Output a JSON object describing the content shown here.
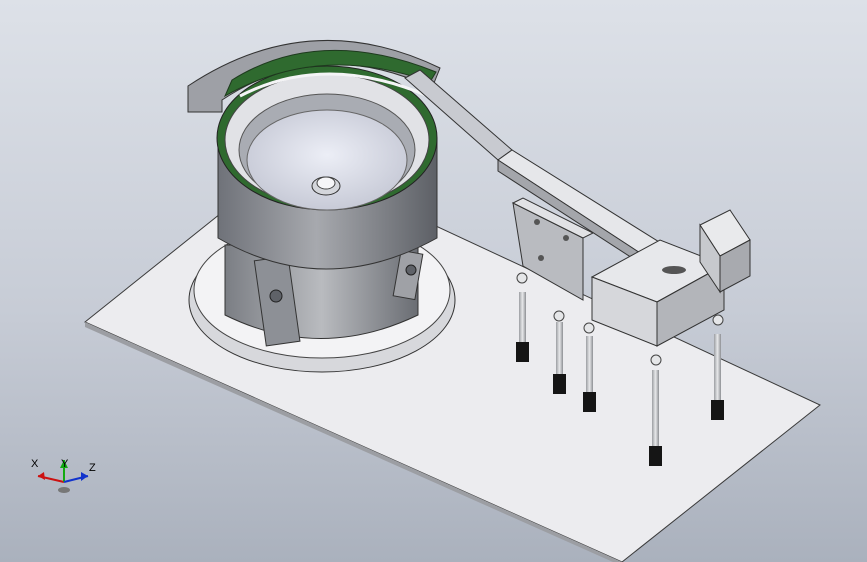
{
  "viewport": {
    "background_top": "#dde1e8",
    "background_bottom": "#aab1bd"
  },
  "model": {
    "parts": [
      "base-plate",
      "vibratory-bowl",
      "bowl-drive-unit",
      "spiral-track",
      "center-bolt",
      "linear-feed-track",
      "bracket-plate",
      "escapement-block",
      "cylinder-actuator",
      "support-legs"
    ],
    "colors": {
      "plate": "#ececef",
      "metal": "#9a9ca2",
      "track_liner": "#2f6a2f",
      "bolt_tip": "#151515"
    }
  },
  "triad": {
    "x_label": "X",
    "y_label": "Y",
    "z_label": "Z",
    "x_color": "#cc1111",
    "y_color": "#11aa11",
    "z_color": "#1133cc"
  }
}
